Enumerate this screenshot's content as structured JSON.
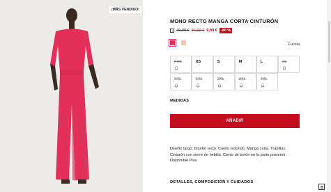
{
  "product": {
    "badge": "¡MÁS VENDIDO!",
    "title": "MONO RECTO MANGA CORTA CINTURÓN",
    "price_original": "49,99 €",
    "price_previous": "34,99 €",
    "price_current": "9,99 €",
    "discount": "-80 %",
    "color_name": "Fucsia",
    "swatch_colors": [
      "#e2305a",
      "#efc8b9"
    ],
    "sizes": [
      {
        "label": "XXS",
        "available": false
      },
      {
        "label": "XS",
        "available": true
      },
      {
        "label": "S",
        "available": true
      },
      {
        "label": "M",
        "available": true
      },
      {
        "label": "L",
        "available": true
      },
      {
        "label": "XL",
        "available": false
      },
      {
        "label": "XXL",
        "available": false
      },
      {
        "label": "1XL",
        "available": false
      },
      {
        "label": "2XL",
        "available": false
      },
      {
        "label": "3XL",
        "available": false
      },
      {
        "label": "4XL",
        "available": false
      }
    ],
    "measures_label": "MEDIDAS",
    "add_button": "AÑADIR",
    "description_lines": [
      "Diseño largo. Diseño recto. Cuello redondo. Manga corta. Trabillas.",
      "Cinturón con cierre de hebilla. Cierre de botón en la parte posterior.",
      "Disponible Plus"
    ],
    "details_label": "DETALLES, COMPOSICIÓN Y CUIDADOS"
  },
  "colors": {
    "accent": "#c40d1c",
    "garment": "#e2305a"
  }
}
